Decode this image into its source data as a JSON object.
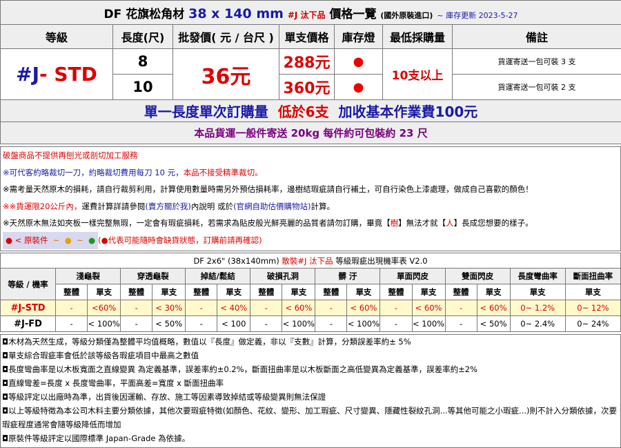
{
  "header": {
    "brand": "DF 花旗松角材",
    "size": "38 x 140 mm",
    "tag": "#J 汰下品",
    "list": "價格一覽",
    "origin": "(國外原裝進口)",
    "update": "~ 庫存更新 2023-5-27"
  },
  "columns": [
    "等級",
    "長度(尺)",
    "批發價( 元 / 台尺 )",
    "單支價格",
    "庫存燈",
    "最低採購量",
    "備註"
  ],
  "product": {
    "grade_prefix": "#J",
    "grade_suffix": "- STD",
    "wholesale": "36元",
    "min_qty": "10支以上",
    "rows": [
      {
        "length": "8",
        "price": "288元",
        "stock": "●",
        "note": "貨運寄送一包可裝 3 支"
      },
      {
        "length": "10",
        "price": "360元",
        "stock": "●",
        "note": "貨運寄送一包可裝 2 支"
      }
    ]
  },
  "notice": {
    "line1_a": "單一長度單次訂購量",
    "line1_b": "低於6支",
    "line1_c": "加收基本作業費100元",
    "line2": "本品貨運一般件寄送 20kg 每件約可包裝約 23 尺"
  },
  "info": {
    "l1": "破盤商品不提供再刨光或剖切加工服務",
    "l2a": "※可代客約略裁切一刀，約略裁切費用每刀 10 元，",
    "l2b": "本品不接受精準裁切。",
    "l3": "※需考量天然原木的損耗，請自行裁剪利用，計算使用數量時需另外預估損耗率，邊樹結瑕疵請自行補土，可自行染色上漆處理，做成自己喜歡的顏色！",
    "l4a": "※",
    "l4b": "※貨運限20公斤內，",
    "l4c": "運費計算詳請參閱",
    "l4d": "(賣方關於我)",
    "l4e": "內說明 或於",
    "l4f": "(官網自助估價購物站)",
    "l4g": "計算。",
    "l5a": "※天然原木無法如夾板一樣完整無瑕，一定會有瑕疵損耗，若需求為貼皮般光鮮亮麗的品質者請勿訂購，畢竟【",
    "l5b": "樹",
    "l5c": "】無法才就【",
    "l5d": "人",
    "l5e": "】長成您想要的樣子。",
    "legend_pre": "● < 原裝件",
    "legend_tilde1": "~",
    "legend_dot2": "●",
    "legend_tilde2": "~",
    "legend_dot3": "●",
    "legend_note": "(●代表可能隨時會缺貨狀態，訂購前請再確認)"
  },
  "defect": {
    "title_a": "DF 2x6\" (38x140mm)",
    "title_b": "散裝#J 汰下品",
    "title_c": "等級瑕疵出現機率表 V2.0",
    "grade_header": "等級 / 機率",
    "groups": [
      "淺龜裂",
      "穿透龜裂",
      "掉結/鬆結",
      "破損孔洞",
      "髒 汙",
      "單面閃皮",
      "雙面閃皮",
      "長度彎曲率",
      "斷面扭曲率"
    ],
    "sub_whole": "整體",
    "sub_single": "單支",
    "rows": [
      {
        "name": "#J-STD",
        "cells": [
          "-",
          "<60%",
          "-",
          "< 30%",
          "-",
          "< 40%",
          "-",
          "< 60%",
          "-",
          "< 60%",
          "-",
          "< 60%",
          "-",
          "< 60%",
          "0~ 1.2%",
          "0~ 12%"
        ]
      },
      {
        "name": "#J-FD",
        "cells": [
          "-",
          "< 100%",
          "-",
          "< 50%",
          "-",
          "< 100",
          "-",
          "< 100%",
          "-",
          "< 100%",
          "-",
          "< 100%",
          "-",
          "< 50%",
          "0~ 2.4%",
          "0~ 24%"
        ]
      }
    ]
  },
  "footnotes": [
    "◘木材為天然生成，等級分類僅為整體平均值概略，數值以『長度』做定義，非以『支數』計算，分類誤差率約± 5%",
    "◘單支綜合瑕疵率會低於該等級各瑕疵項目中最高之數值",
    "◘長度彎曲率是以木板寬面之直線變異 為定義基準，誤差率約±0.2%，斷面扭曲率是以木板斷面之高低變異為定義基準，誤差率約±2%",
    "◘直線彎差=長度 x 長度彎曲率，平面高差=寬度 x 斷面扭曲率",
    "◘等級評定以出廠時為準，出貨後因運輸、存放、施工等因素導致掉結或等級變異則無法保證",
    "◘以上等級特徵為本公司木料主要分類依據，其他次要瑕疵特徵(如顏色、花紋、變形、加工瑕疵、尺寸變異、隱藏性裂紋孔洞...等其他可能之小瑕疵...)則不計入分類依據，次要瑕疵程度通常會隨等級降低而增加",
    "◘原裝件等級評定以國際標準 Japan-Grade 為依據。"
  ]
}
